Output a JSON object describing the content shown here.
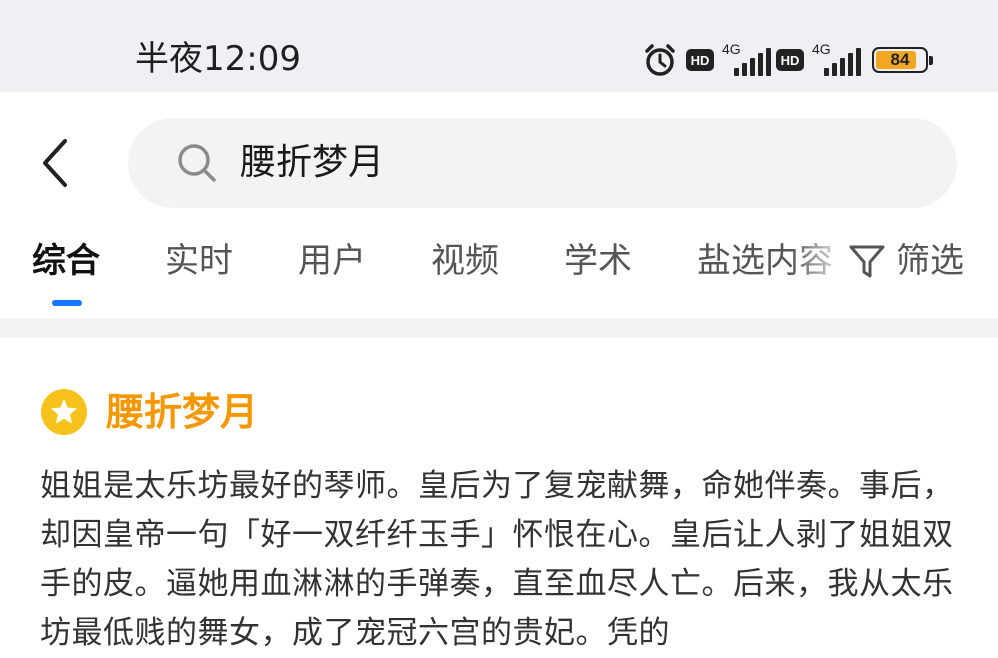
{
  "status_bar": {
    "time": "半夜12:09",
    "hd_label": "HD",
    "network_type": "4G",
    "battery_level": "84",
    "battery_fraction": 0.84,
    "icons": [
      "alarm-icon",
      "hd-icon",
      "signal-icon",
      "hd-icon",
      "signal-icon",
      "battery-icon"
    ]
  },
  "search": {
    "query": "腰折梦月"
  },
  "tabs": [
    {
      "label": "综合",
      "active": true
    },
    {
      "label": "实时",
      "active": false
    },
    {
      "label": "用户",
      "active": false
    },
    {
      "label": "视频",
      "active": false
    },
    {
      "label": "学术",
      "active": false
    },
    {
      "label": "盐选内容",
      "active": false
    }
  ],
  "filter": {
    "label": "筛选"
  },
  "card": {
    "title": "腰折梦月",
    "body": "姐姐是太乐坊最好的琴师。皇后为了复宠献舞，命她伴奏。事后，却因皇帝一句「好一双纤纤玉手」怀恨在心。皇后让人剥了姐姐双手的皮。逼她用血淋淋的手弹奏，直至血尽人亡。后来，我从太乐坊最低贱的舞女，成了宠冠六宫的贵妃。凭的"
  },
  "colors": {
    "accent": "#1677ff",
    "title": "#f39800",
    "star_badge": "#f7c21b",
    "battery": "#f5a623"
  }
}
